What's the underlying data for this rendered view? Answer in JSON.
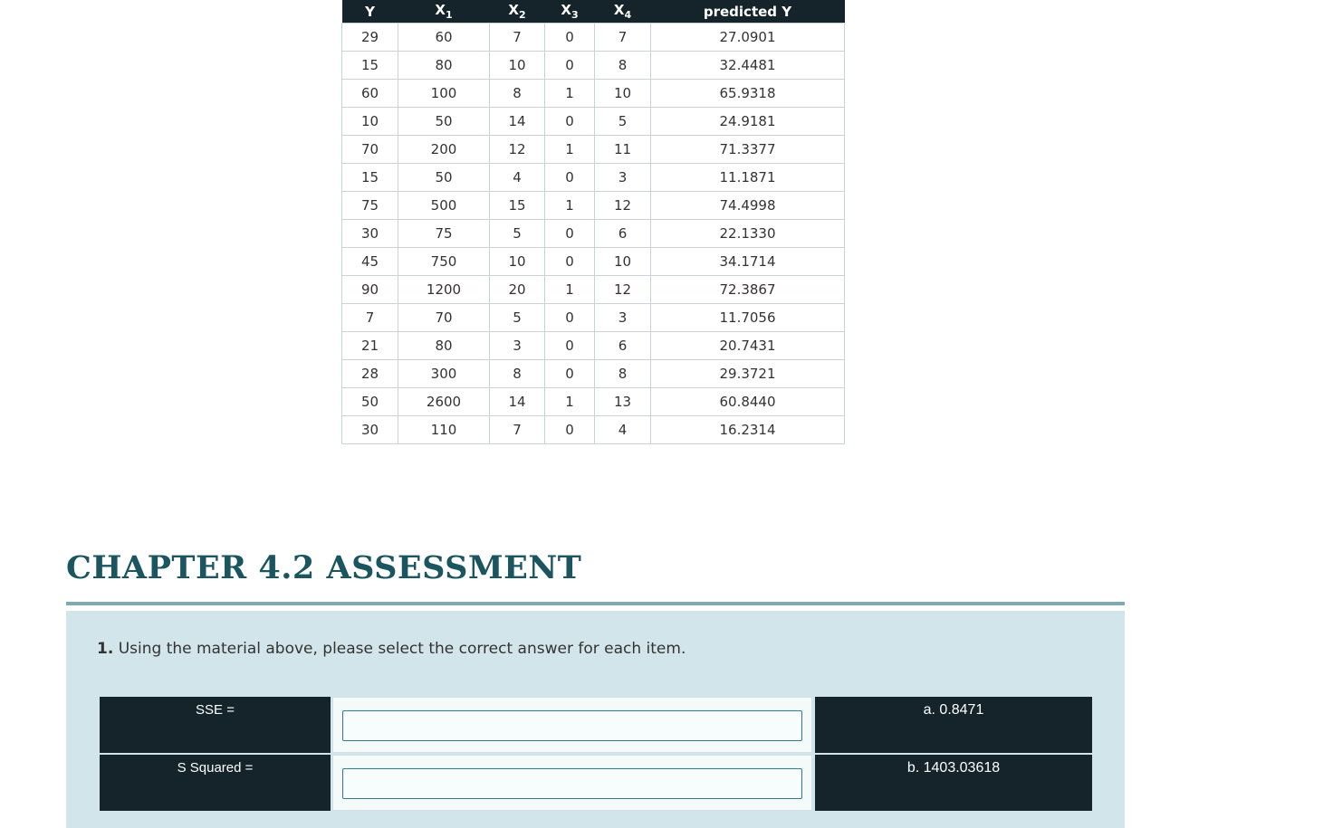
{
  "table": {
    "headers": [
      {
        "base": "Y",
        "sub": ""
      },
      {
        "base": "X",
        "sub": "1"
      },
      {
        "base": "X",
        "sub": "2"
      },
      {
        "base": "X",
        "sub": "3"
      },
      {
        "base": "X",
        "sub": "4"
      },
      {
        "base": "predicted Y",
        "sub": ""
      }
    ],
    "rows": [
      [
        "29",
        "60",
        "7",
        "0",
        "7",
        "27.0901"
      ],
      [
        "15",
        "80",
        "10",
        "0",
        "8",
        "32.4481"
      ],
      [
        "60",
        "100",
        "8",
        "1",
        "10",
        "65.9318"
      ],
      [
        "10",
        "50",
        "14",
        "0",
        "5",
        "24.9181"
      ],
      [
        "70",
        "200",
        "12",
        "1",
        "11",
        "71.3377"
      ],
      [
        "15",
        "50",
        "4",
        "0",
        "3",
        "11.1871"
      ],
      [
        "75",
        "500",
        "15",
        "1",
        "12",
        "74.4998"
      ],
      [
        "30",
        "75",
        "5",
        "0",
        "6",
        "22.1330"
      ],
      [
        "45",
        "750",
        "10",
        "0",
        "10",
        "34.1714"
      ],
      [
        "90",
        "1200",
        "20",
        "1",
        "12",
        "72.3867"
      ],
      [
        "7",
        "70",
        "5",
        "0",
        "3",
        "11.7056"
      ],
      [
        "21",
        "80",
        "3",
        "0",
        "6",
        "20.7431"
      ],
      [
        "28",
        "300",
        "8",
        "0",
        "8",
        "29.3721"
      ],
      [
        "50",
        "2600",
        "14",
        "1",
        "13",
        "60.8440"
      ],
      [
        "30",
        "110",
        "7",
        "0",
        "4",
        "16.2314"
      ]
    ]
  },
  "chapter_title": "CHAPTER 4.2 ASSESSMENT",
  "question": {
    "number": "1.",
    "text": "Using the material above, please select the correct answer for each item."
  },
  "matching": [
    {
      "term": "SSE =",
      "answer_value": "",
      "option": "a. 0.8471"
    },
    {
      "term": "S Squared =",
      "answer_value": "",
      "option": "b. 1403.03618"
    }
  ],
  "colors": {
    "header_bg": "#15242a",
    "title": "#1a5560",
    "panel_bg": "#d2e5ea",
    "rule": "#7eaab1"
  }
}
